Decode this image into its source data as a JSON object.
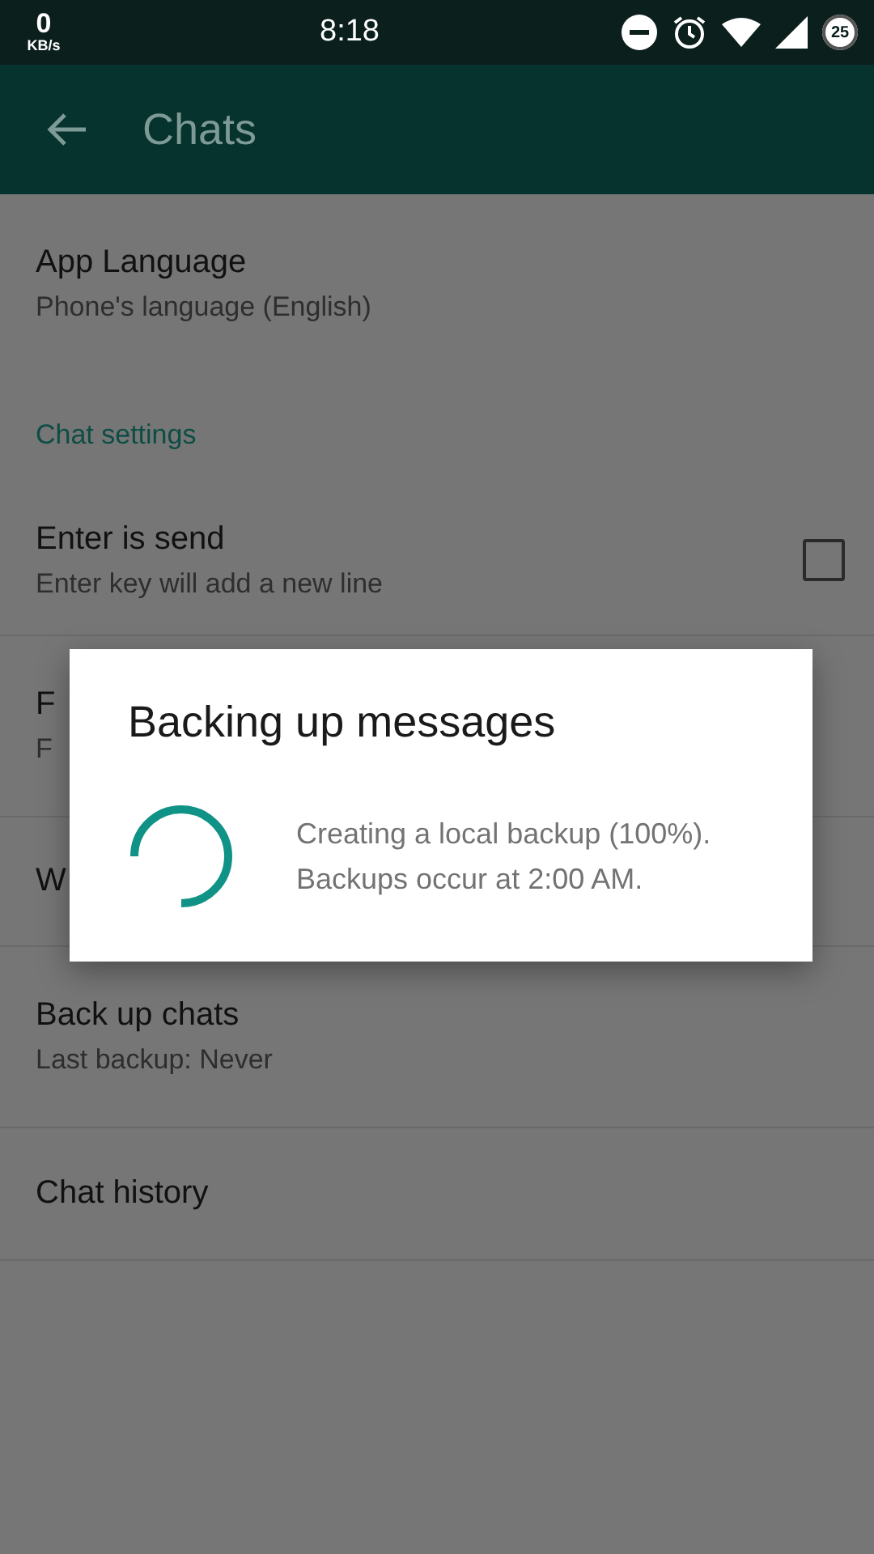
{
  "status_bar": {
    "speed": "0",
    "speed_unit": "KB/s",
    "time": "8:18",
    "battery": "25"
  },
  "app_bar": {
    "title": "Chats"
  },
  "settings": [
    {
      "kind": "item",
      "title": "App Language",
      "subtitle": "Phone's language (English)"
    },
    {
      "kind": "header",
      "title": "Chat settings"
    },
    {
      "kind": "item",
      "title": "Enter is send",
      "subtitle": "Enter key will add a new line",
      "checked": false
    },
    {
      "kind": "item",
      "title": "F",
      "subtitle": "F"
    },
    {
      "kind": "item",
      "title": "W"
    },
    {
      "kind": "item",
      "title": "Back up chats",
      "subtitle": "Last backup: Never"
    },
    {
      "kind": "item",
      "title": "Chat history"
    }
  ],
  "dialog": {
    "title": "Backing up messages",
    "message_lines": [
      "Creating a local backup (100%).",
      "Backups occur at 2:00 AM."
    ]
  }
}
